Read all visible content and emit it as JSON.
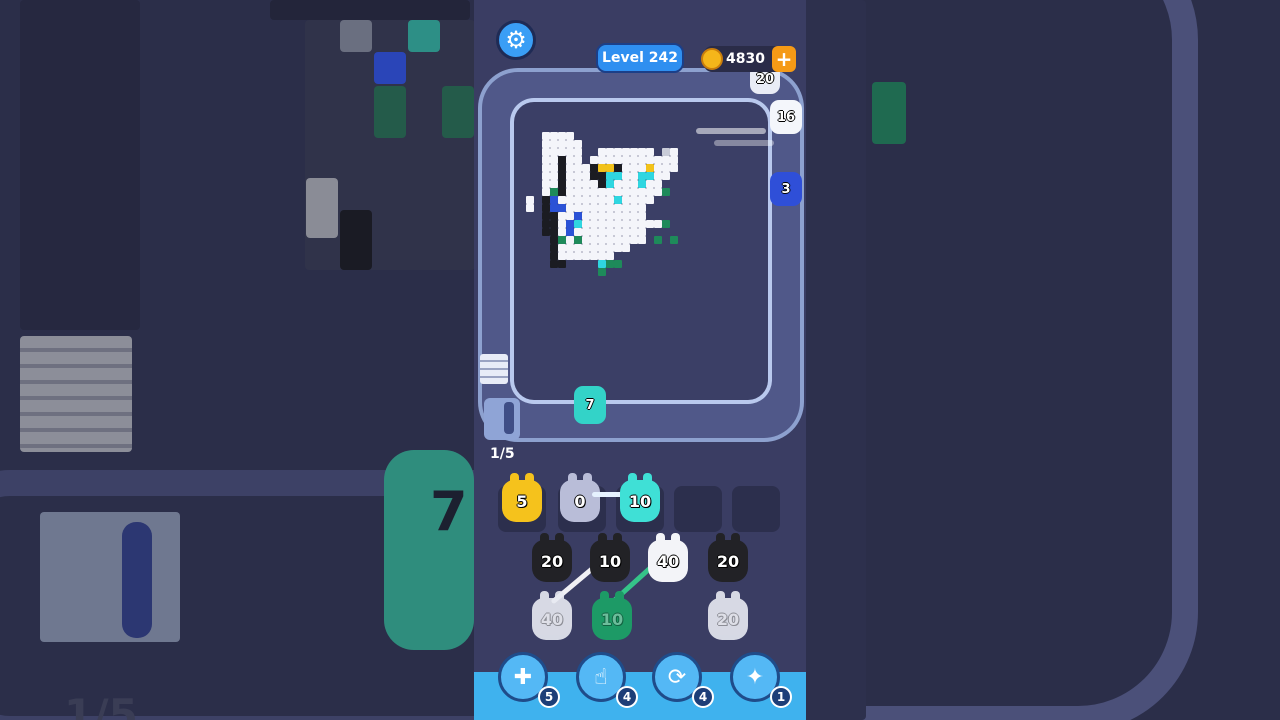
{
  "hud": {
    "settings_icon": "gear-icon",
    "level_label": "Level 242",
    "coins": "4830",
    "coins_add": "+"
  },
  "conveyor_shooters": [
    {
      "value": "20",
      "color": "#e9ecf6"
    },
    {
      "value": "16",
      "color": "#f4f6fb"
    },
    {
      "value": "3",
      "color": "#2f4fd8"
    },
    {
      "value": "7",
      "color": "#33d3c8"
    }
  ],
  "queue_progress": "1/5",
  "holding_slots": [
    {
      "value": "5",
      "color": "#f5c21c"
    },
    {
      "value": "0",
      "color": "#b9bdd8"
    },
    {
      "value": "10",
      "color": "#3fe0d6"
    },
    {
      "value": "",
      "color": ""
    },
    {
      "value": "",
      "color": ""
    }
  ],
  "grid_units": [
    {
      "value": "20",
      "color": "#222226"
    },
    {
      "value": "10",
      "color": "#222226"
    },
    {
      "value": "40",
      "color": "#f3f4f8"
    },
    {
      "value": "20",
      "color": "#222226"
    },
    {
      "value": "40",
      "color": "#e8eaf2"
    },
    {
      "value": "10",
      "color": "#1d9a66"
    },
    {
      "value": "20",
      "color": "#e8eaf2"
    }
  ],
  "boosters": [
    {
      "icon": "add-slot-icon",
      "glyph": "✚",
      "count": "5"
    },
    {
      "icon": "hand-icon",
      "glyph": "☝",
      "count": "4"
    },
    {
      "icon": "shuffle-icon",
      "glyph": "⟳",
      "count": "4"
    },
    {
      "icon": "magic-icon",
      "glyph": "✦",
      "count": "1"
    }
  ],
  "background_mirror": {
    "big_unit_value": "7",
    "progress": "1/5"
  }
}
